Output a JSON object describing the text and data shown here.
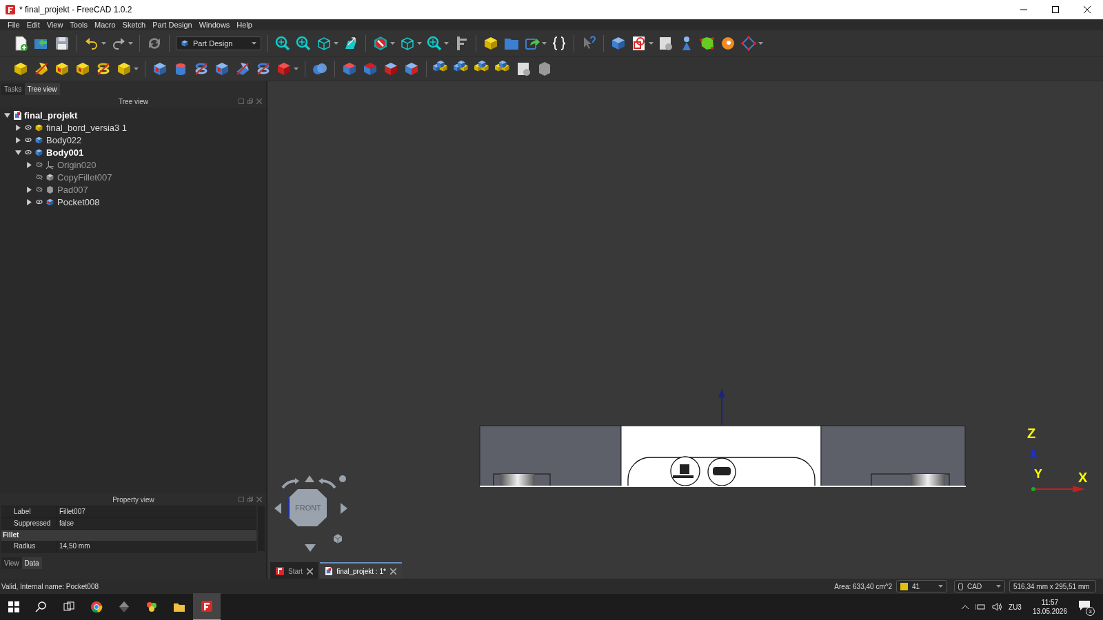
{
  "window": {
    "title": "* final_projekt - FreeCAD 1.0.2"
  },
  "menu": [
    "File",
    "Edit",
    "View",
    "Tools",
    "Macro",
    "Sketch",
    "Part Design",
    "Windows",
    "Help"
  ],
  "toolbar": {
    "workbench": "Part Design"
  },
  "left_panel": {
    "tabs": [
      {
        "label": "Tasks",
        "selected": false
      },
      {
        "label": "Tree view",
        "selected": true
      }
    ],
    "tree_view": {
      "title": "Tree view",
      "document": {
        "label": "final_projekt",
        "expanded": true
      },
      "items": [
        {
          "label": "final_bord_versia3 1",
          "kind": "part",
          "expandable": true,
          "expanded": false,
          "visible": true,
          "active": false
        },
        {
          "label": "Body022",
          "kind": "body",
          "expandable": true,
          "expanded": false,
          "visible": true,
          "active": false
        },
        {
          "label": "Body001",
          "kind": "body",
          "expandable": true,
          "expanded": true,
          "visible": true,
          "active": true,
          "children": [
            {
              "label": "Origin020",
              "kind": "origin",
              "expandable": true,
              "expanded": false,
              "visible": false,
              "active": false
            },
            {
              "label": "CopyFillet007",
              "kind": "copy",
              "expandable": false,
              "visible": false,
              "active": false
            },
            {
              "label": "Pad007",
              "kind": "pad",
              "expandable": true,
              "expanded": false,
              "visible": false,
              "active": false
            },
            {
              "label": "Pocket008",
              "kind": "pocket",
              "expandable": true,
              "expanded": false,
              "visible": true,
              "active": false
            }
          ]
        }
      ]
    },
    "property_view": {
      "title": "Property view",
      "rows": [
        {
          "kind": "property",
          "name": "Label",
          "value": "Fillet007"
        },
        {
          "kind": "property",
          "name": "Suppressed",
          "value": "false"
        },
        {
          "kind": "group",
          "name": "Fillet"
        },
        {
          "kind": "property",
          "name": "Radius",
          "value": "14,50 mm"
        }
      ],
      "tabs": [
        {
          "label": "View",
          "selected": false
        },
        {
          "label": "Data",
          "selected": true
        }
      ]
    }
  },
  "viewport": {
    "nav_cube": {
      "face": "FRONT"
    },
    "axis": {
      "z": "Z",
      "y": "Y",
      "x": "X"
    },
    "document_tabs": [
      {
        "label": "Start",
        "kind": "start",
        "selected": false
      },
      {
        "label": "final_projekt : 1*",
        "kind": "document",
        "selected": true
      }
    ]
  },
  "status_bar": {
    "message": "Valid, Internal name: Pocket008",
    "area": "Area: 633,40 cm^2",
    "combo_1": "41",
    "navigation_style": "CAD",
    "dimensions": "516,34 mm x 295,51 mm"
  },
  "taskbar": {
    "language": "ZU3",
    "time": "11:57",
    "date": "13.05.2026",
    "notifications": "3"
  }
}
